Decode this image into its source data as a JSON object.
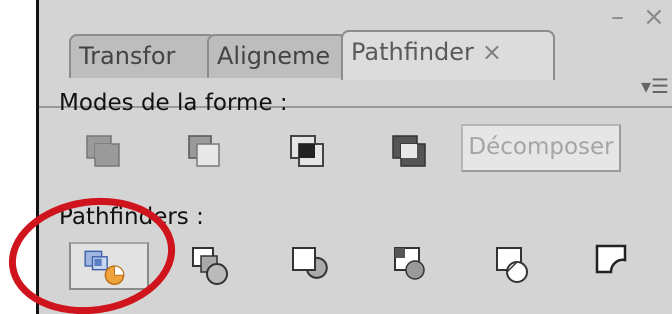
{
  "window": {
    "minimize_glyph": "–",
    "close_glyph": "×"
  },
  "tabs": [
    {
      "label": "Transfor",
      "active": false
    },
    {
      "label": "Aligneme",
      "active": false
    },
    {
      "label": "Pathfinder",
      "active": true,
      "close_glyph": "×"
    }
  ],
  "panel_menu_glyph": "▾☰",
  "shape_modes": {
    "heading": "Modes de la forme :",
    "icons": [
      "add-to-shape-area-icon",
      "subtract-from-shape-area-icon",
      "intersect-shape-areas-icon",
      "exclude-overlapping-shape-areas-icon"
    ],
    "expand_label": "Décomposer"
  },
  "pathfinders": {
    "heading": "Pathfinders :",
    "icons": [
      "divide-icon",
      "trim-icon",
      "merge-icon",
      "crop-icon",
      "outline-icon",
      "minus-back-icon"
    ],
    "selected": "divide-icon"
  },
  "colors": {
    "highlight_circle": "#d0141e",
    "divide_orange": "#f0a23c",
    "divide_blue": "#5b7fc4"
  }
}
